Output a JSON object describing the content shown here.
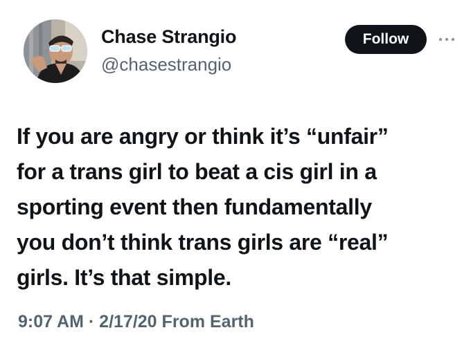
{
  "author": {
    "name": "Chase Strangio",
    "handle": "@chasestrangio"
  },
  "follow_label": "Follow",
  "more_icon": "more-horizontal-icon",
  "tweet": {
    "lines": [
      "If you are angry or think it’s “unfair”",
      "for a trans girl to beat a cis girl in a",
      "sporting event then fundamentally",
      "you don’t think trans girls are “real”",
      "girls. It’s that simple."
    ]
  },
  "meta": {
    "time": "9:07 AM",
    "separator": "·",
    "date": "2/17/20",
    "source": "From Earth"
  },
  "colors": {
    "text": "#0f1419",
    "secondary": "#536471",
    "button_bg": "#0f1419",
    "button_text": "#ffffff"
  }
}
